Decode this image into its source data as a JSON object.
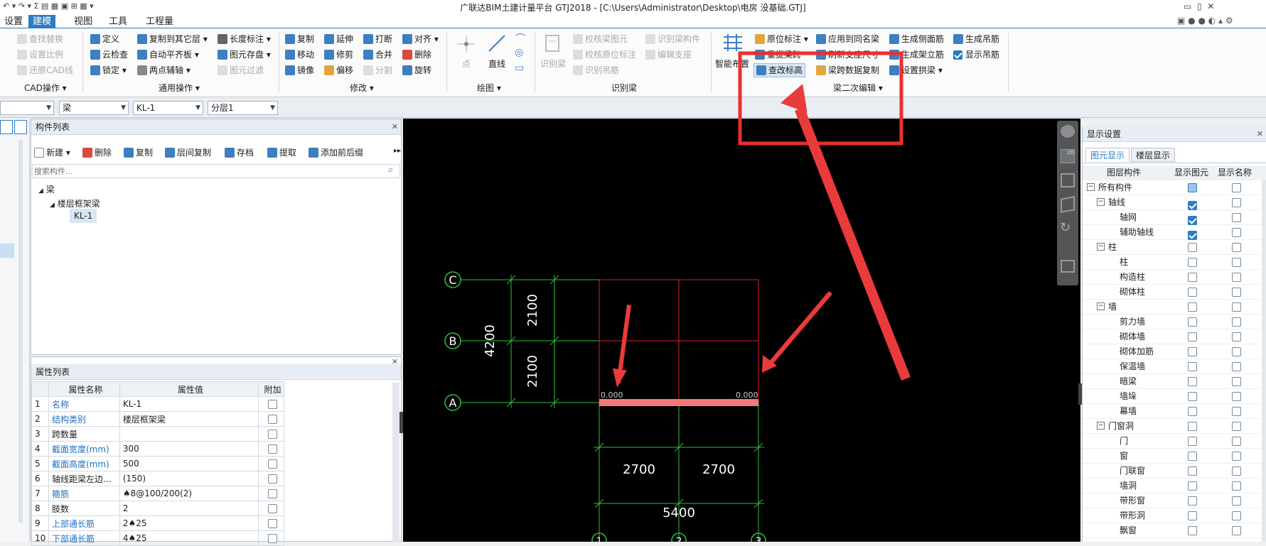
{
  "window": {
    "title": "广联达BIM土建计量平台 GTJ2018 - [C:\\Users\\Administrator\\Desktop\\电房 没基础.GTJ]"
  },
  "menu": {
    "items": [
      "设置",
      "建模",
      "视图",
      "工具",
      "工程量"
    ],
    "active": "建模"
  },
  "ribbon": {
    "cad": {
      "items": [
        "查找替换",
        "设置比例",
        "还原CAD线"
      ],
      "label": "CAD操作 ▾"
    },
    "general": {
      "items": [
        "定义",
        "复制到其它层 ▾",
        "长度标注 ▾",
        "云检查",
        "自动平齐板 ▾",
        "图元存盘 ▾",
        "锁定 ▾",
        "两点辅轴 ▾",
        "图元过滤"
      ],
      "label": "通用操作 ▾"
    },
    "modify": {
      "items": [
        "复制",
        "延伸",
        "打断",
        "对齐 ▾",
        "移动",
        "修剪",
        "合并",
        "删除",
        "镜像",
        "偏移",
        "分割",
        "旋转"
      ],
      "label": "修改 ▾"
    },
    "draw": {
      "items": [
        "点",
        "直线"
      ],
      "label": "绘图 ▾"
    },
    "recog": {
      "items": [
        "识别梁",
        "校核梁图元",
        "识别梁构件",
        "校核原位标注",
        "编辑支座",
        "识别吊筋"
      ],
      "label": "识别梁"
    },
    "beam2": {
      "items": [
        "智能布置",
        "原位标注 ▾",
        "应用到同名梁",
        "生成侧面筋",
        "生成吊筋",
        "重提梁跨",
        "刷新支座尺寸",
        "生成架立筋",
        "显示吊筋",
        "查改标高",
        "梁跨数据复制",
        "设置拱梁 ▾"
      ],
      "label": "梁二次编辑 ▾"
    }
  },
  "selectors": {
    "type": "梁",
    "name": "KL-1",
    "layer": "分层1"
  },
  "component_list": {
    "title": "构件列表",
    "toolbar": [
      "新建 ▾",
      "删除",
      "复制",
      "层间复制",
      "存档",
      "提取",
      "添加前后缀"
    ],
    "search_placeholder": "搜索构件...",
    "tree": {
      "root": "梁",
      "child": "楼层框架梁",
      "leaf": "KL-1"
    }
  },
  "props": {
    "title": "属性列表",
    "headers": [
      "属性名称",
      "属性值",
      "附加"
    ],
    "rows": [
      {
        "n": "1",
        "name": "名称",
        "value": "KL-1",
        "blue": true
      },
      {
        "n": "2",
        "name": "结构类别",
        "value": "楼层框架梁",
        "blue": true
      },
      {
        "n": "3",
        "name": "跨数量",
        "value": "",
        "blue": false
      },
      {
        "n": "4",
        "name": "截面宽度(mm)",
        "value": "300",
        "blue": true
      },
      {
        "n": "5",
        "name": "截面高度(mm)",
        "value": "500",
        "blue": true
      },
      {
        "n": "6",
        "name": "轴线距梁左边...",
        "value": "(150)",
        "blue": false
      },
      {
        "n": "7",
        "name": "箍筋",
        "value": "♠8@100/200(2)",
        "blue": true
      },
      {
        "n": "8",
        "name": "肢数",
        "value": "2",
        "blue": false
      },
      {
        "n": "9",
        "name": "上部通长筋",
        "value": "2♠25",
        "blue": true
      },
      {
        "n": "10",
        "name": "下部通长筋",
        "value": "4♠25",
        "blue": true
      }
    ]
  },
  "drawing": {
    "axes_v": [
      "C",
      "B",
      "A"
    ],
    "axes_h": [
      "1",
      "2",
      "3"
    ],
    "dims_v": [
      "2100",
      "2100",
      "4200"
    ],
    "dims_h": [
      "2700",
      "2700",
      "5400"
    ],
    "elev": [
      "0.000",
      "0.000"
    ]
  },
  "display": {
    "title": "显示设置",
    "tabs": [
      "图元显示",
      "楼层显示"
    ],
    "headers": [
      "图层构件",
      "显示图元",
      "显示名称"
    ],
    "rows": [
      {
        "name": "所有构件",
        "level": 0,
        "exp": "−",
        "show": "part",
        "label": false
      },
      {
        "name": "轴线",
        "level": 1,
        "exp": "−",
        "show": "on",
        "label": false
      },
      {
        "name": "轴网",
        "level": 2,
        "exp": "",
        "show": "on",
        "label": false
      },
      {
        "name": "辅助轴线",
        "level": 2,
        "exp": "",
        "show": "on",
        "label": false
      },
      {
        "name": "柱",
        "level": 1,
        "exp": "−",
        "show": "off",
        "label": false
      },
      {
        "name": "柱",
        "level": 2,
        "exp": "",
        "show": "off",
        "label": false
      },
      {
        "name": "构造柱",
        "level": 2,
        "exp": "",
        "show": "off",
        "label": false
      },
      {
        "name": "砌体柱",
        "level": 2,
        "exp": "",
        "show": "off",
        "label": false
      },
      {
        "name": "墙",
        "level": 1,
        "exp": "−",
        "show": "off",
        "label": false
      },
      {
        "name": "剪力墙",
        "level": 2,
        "exp": "",
        "show": "off",
        "label": false
      },
      {
        "name": "砌体墙",
        "level": 2,
        "exp": "",
        "show": "off",
        "label": false
      },
      {
        "name": "砌体加筋",
        "level": 2,
        "exp": "",
        "show": "off",
        "label": false
      },
      {
        "name": "保温墙",
        "level": 2,
        "exp": "",
        "show": "off",
        "label": false
      },
      {
        "name": "暗梁",
        "level": 2,
        "exp": "",
        "show": "off",
        "label": false
      },
      {
        "name": "墙垛",
        "level": 2,
        "exp": "",
        "show": "off",
        "label": false
      },
      {
        "name": "幕墙",
        "level": 2,
        "exp": "",
        "show": "off",
        "label": false
      },
      {
        "name": "门窗洞",
        "level": 1,
        "exp": "−",
        "show": "off",
        "label": false
      },
      {
        "name": "门",
        "level": 2,
        "exp": "",
        "show": "off",
        "label": false
      },
      {
        "name": "窗",
        "level": 2,
        "exp": "",
        "show": "off",
        "label": false
      },
      {
        "name": "门联窗",
        "level": 2,
        "exp": "",
        "show": "off",
        "label": false
      },
      {
        "name": "墙洞",
        "level": 2,
        "exp": "",
        "show": "off",
        "label": false
      },
      {
        "name": "带形窗",
        "level": 2,
        "exp": "",
        "show": "off",
        "label": false
      },
      {
        "name": "带形洞",
        "level": 2,
        "exp": "",
        "show": "off",
        "label": false
      },
      {
        "name": "飘窗",
        "level": 2,
        "exp": "",
        "show": "off",
        "label": false
      }
    ]
  },
  "colors": {
    "accent": "#2c7cc3",
    "annotation": "#e8302f",
    "grid": "#2fbf3a",
    "beam": "#f07a7a"
  }
}
